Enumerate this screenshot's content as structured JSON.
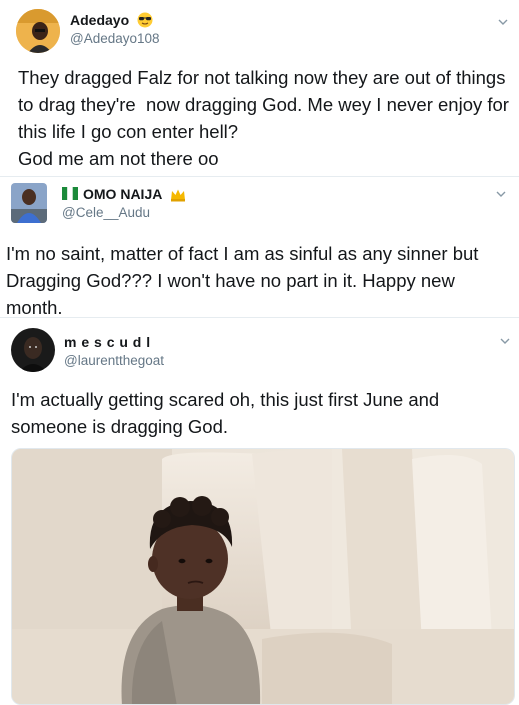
{
  "tweets": [
    {
      "name": "Adedayo",
      "name_emoji": "sunglasses-face",
      "handle": "@Adedayo108",
      "text": "They dragged Falz for not talking now they are out of things to drag they're  now dragging God. Me wey I never enjoy for this life I go con enter hell?\nGod me am not there oo"
    },
    {
      "name": "OMO NAIJA",
      "name_prefix_emoji": "nigeria-flag",
      "name_emoji": "crown",
      "handle": "@Cele__Audu",
      "text": "I'm no saint, matter of fact I am as sinful as any sinner but Dragging God??? I won't have no part in it. Happy new month."
    },
    {
      "name": "m e s c u d l",
      "handle": "@laurentthegoat",
      "text": "I'm actually getting scared oh, this just first June and someone is dragging God.",
      "media": "toddler-sitting-on-couch-photo"
    }
  ],
  "colors": {
    "text": "#14171a",
    "secondary": "#657786",
    "divider": "#e6ecf0"
  }
}
